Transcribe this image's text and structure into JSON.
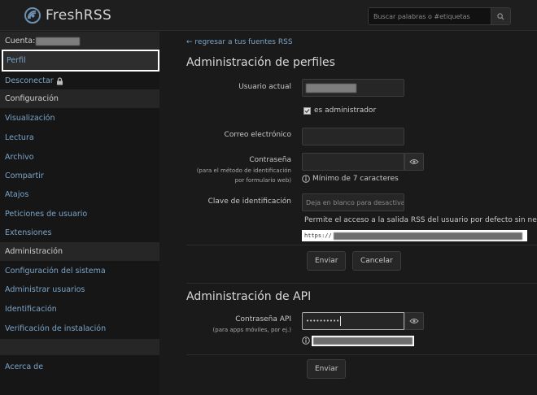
{
  "app": {
    "name": "FreshRSS"
  },
  "search": {
    "placeholder": "Buscar palabras o #etiquetas"
  },
  "sidebar": {
    "account_label": "Cuenta:",
    "perfil": "Perfil",
    "logout": "Desconectar",
    "config_header": "Configuración",
    "config_items": [
      "Visualización",
      "Lectura",
      "Archivo",
      "Compartir",
      "Atajos",
      "Peticiones de usuario",
      "Extensiones"
    ],
    "admin_header": "Administración",
    "admin_items": [
      "Configuración del sistema",
      "Administrar usuarios",
      "Identificación",
      "Verificación de instalación"
    ],
    "about": "Acerca de"
  },
  "main": {
    "back_link": "← regresar a tus fuentes RSS",
    "profile_title": "Administración de perfiles",
    "current_user_label": "Usuario actual",
    "is_admin": "es administrador",
    "email_label": "Correo electrónico",
    "password_label": "Contraseña",
    "password_sub1": "(para el método de identificación",
    "password_sub2": "por formulario web)",
    "password_help": "Mínimo de 7 caracteres",
    "token_label": "Clave de identificación",
    "token_placeholder": "Deja en blanco para desactivar",
    "token_help": "Permite el acceso a la salida RSS del usuario por defecto sin necesid",
    "url_prefix": "https://",
    "submit": "Enviar",
    "cancel": "Cancelar",
    "api_title": "Administración de API",
    "api_password_label": "Contraseña API",
    "api_password_sub": "(para apps móviles, por ej.)",
    "api_password_value": "••••••••••",
    "api_submit": "Enviar"
  },
  "colors": {
    "link": "#7aa5c9",
    "background": "#1a1a1a",
    "sidebar_header": "#262626"
  },
  "icons": [
    "freshrss-logo-icon",
    "search-icon",
    "lock-icon",
    "eye-icon",
    "info-icon",
    "checkbox-icon"
  ]
}
